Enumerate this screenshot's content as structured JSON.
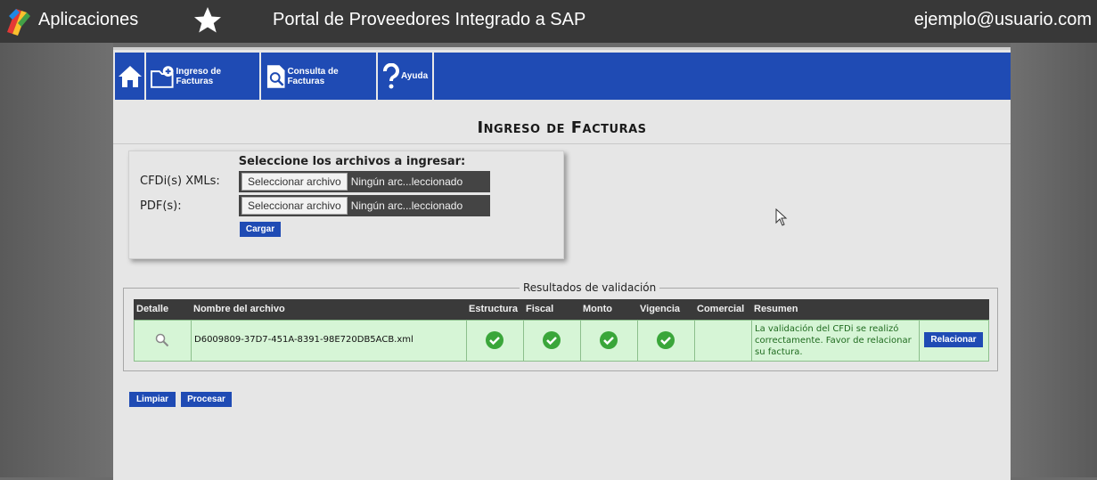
{
  "topbar": {
    "apps_label": "Aplicaciones",
    "portal_title": "Portal de Proveedores Integrado a SAP",
    "user_email": "ejemplo@usuario.com"
  },
  "nav": {
    "ingreso_label": "Ingreso de Facturas",
    "consulta_label": "Consulta de Facturas",
    "ayuda_label": "Ayuda"
  },
  "page": {
    "title": "Ingreso de Facturas"
  },
  "upload": {
    "heading": "Seleccione los archivos a ingresar:",
    "xml_label": "CFDi(s) XMLs:",
    "pdf_label": "PDF(s):",
    "select_button": "Seleccionar archivo",
    "no_file_text": "Ningún arc...leccionado",
    "load_button": "Cargar"
  },
  "results": {
    "legend": "Resultados de validación",
    "columns": [
      "Detalle",
      "Nombre del archivo",
      "Estructura",
      "Fiscal",
      "Monto",
      "Vigencia",
      "Comercial",
      "Resumen"
    ],
    "rows": [
      {
        "filename": "D6009809-37D7-451A-8391-98E720DB5ACB.xml",
        "summary": "La validación del CFDi se realizó correctamente. Favor de relacionar su factura.",
        "action": "Relacionar"
      }
    ]
  },
  "actions": {
    "clear": "Limpiar",
    "process": "Procesar"
  },
  "colors": {
    "nav_blue": "#1f4bb4",
    "row_green": "#d6f5d6",
    "check_green": "#3aa63a"
  }
}
